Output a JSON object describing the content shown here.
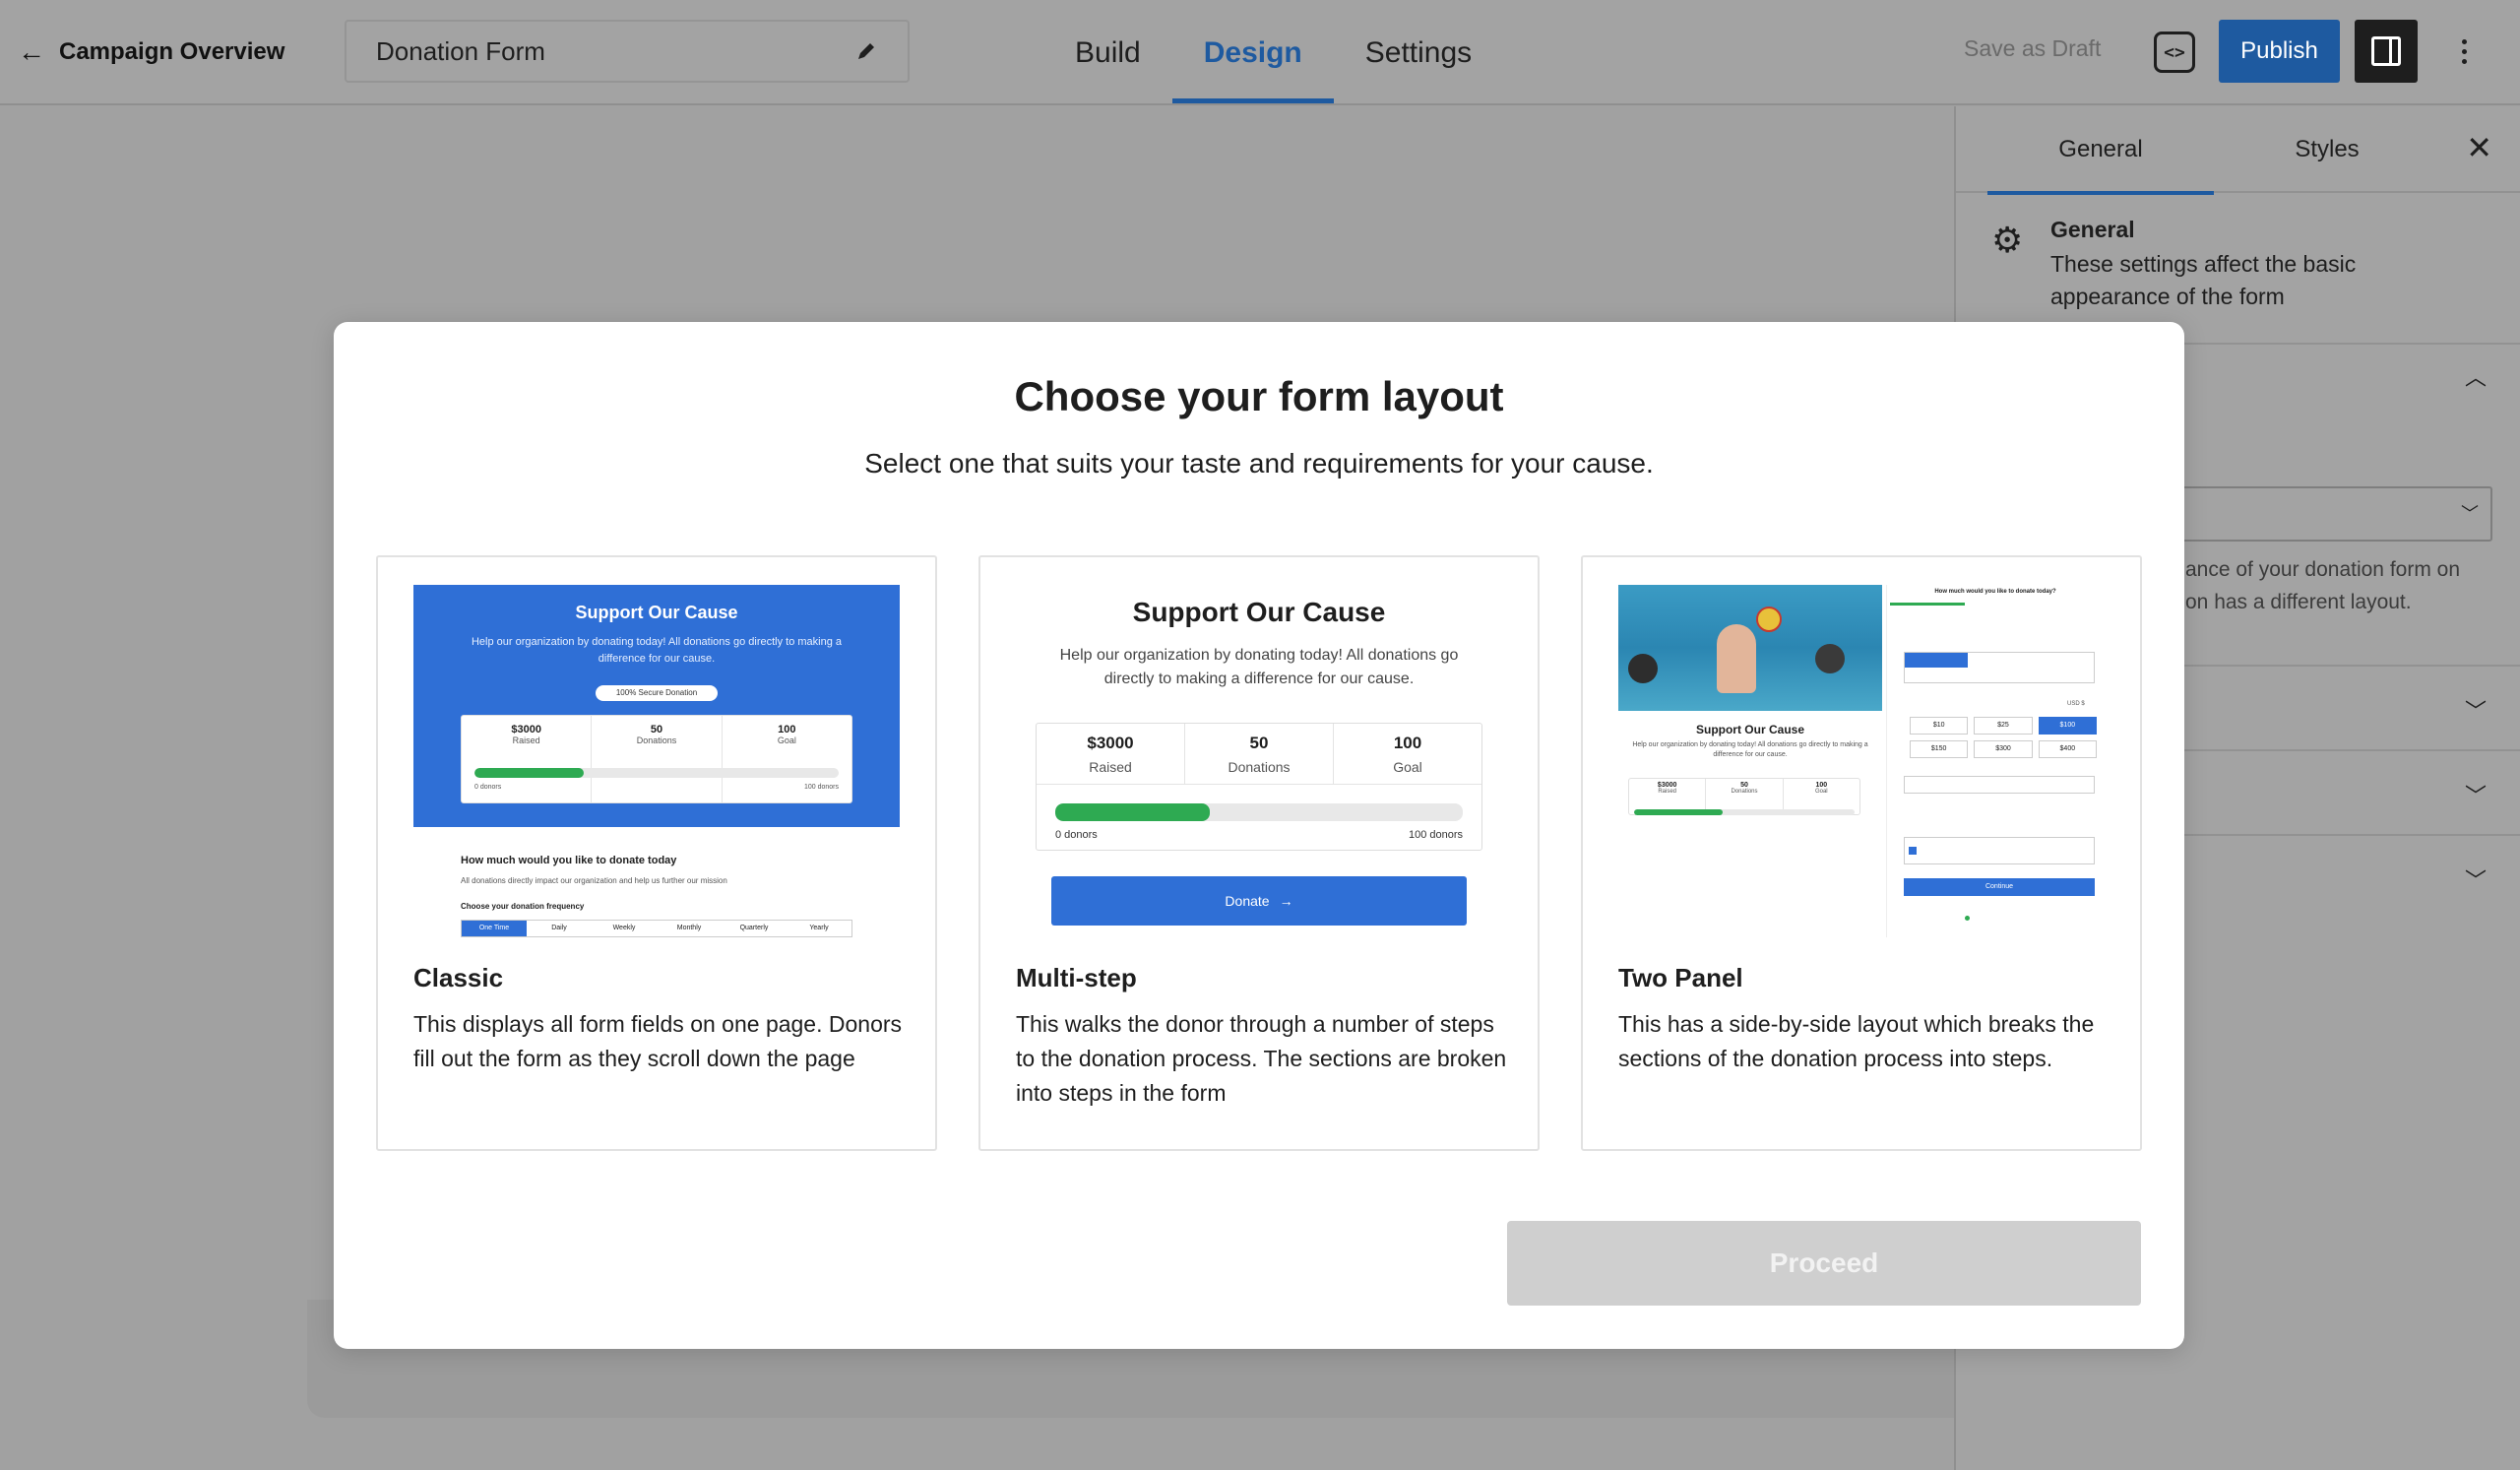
{
  "topbar": {
    "back_label": "Campaign Overview",
    "form_title": "Donation Form",
    "tabs": [
      {
        "label": "Build"
      },
      {
        "label": "Design"
      },
      {
        "label": "Settings"
      }
    ],
    "active_tab": "Design",
    "save_draft": "Save as Draft",
    "publish": "Publish"
  },
  "sidebar": {
    "tabs": [
      {
        "label": "General"
      },
      {
        "label": "Styles"
      }
    ],
    "section_title": "General",
    "section_desc": "These settings affect the basic appearance of the form",
    "partial_desc": "ance of your donation form on\non has a different layout."
  },
  "modal": {
    "title": "Choose your form layout",
    "subtitle": "Select one that suits your taste and requirements for your cause.",
    "proceed": "Proceed",
    "cards": [
      {
        "name": "Classic",
        "desc": "This displays all form fields on one page. Donors fill out the form as they scroll down the page",
        "preview": {
          "title": "Support Our Cause",
          "text": "Help our organization by donating today! All donations go directly to making a difference for our cause.",
          "badge": "100% Secure Donation",
          "stats": [
            {
              "value": "$3000",
              "label": "Raised"
            },
            {
              "value": "50",
              "label": "Donations"
            },
            {
              "value": "100",
              "label": "Goal"
            }
          ],
          "progress": 0.3,
          "bar_left": "0 donors",
          "bar_right": "100 donors",
          "question": "How much would you like to donate today",
          "question_sub": "All donations directly impact our organization and help us further our mission",
          "freq_label": "Choose your donation frequency",
          "freq": [
            "One Time",
            "Daily",
            "Weekly",
            "Monthly",
            "Quarterly",
            "Yearly"
          ]
        }
      },
      {
        "name": "Multi-step",
        "desc": "This walks the donor through a number of steps to the donation process. The sections are broken into steps in the form",
        "preview": {
          "title": "Support Our Cause",
          "text": "Help our organization by donating today! All donations go directly to making a difference for our cause.",
          "stats": [
            {
              "value": "$3000",
              "label": "Raised"
            },
            {
              "value": "50",
              "label": "Donations"
            },
            {
              "value": "100",
              "label": "Goal"
            }
          ],
          "progress": 0.38,
          "bar_left": "0 donors",
          "bar_right": "100 donors",
          "button": "Donate"
        }
      },
      {
        "name": "Two Panel",
        "desc": "This has a side-by-side layout which breaks the sections of the donation process into steps.",
        "preview": {
          "title": "Support Our Cause",
          "text": "Help our organization by donating today! All donations go directly to making a difference for our cause.",
          "stats": [
            {
              "value": "$3000",
              "label": "Raised"
            },
            {
              "value": "50",
              "label": "Donations"
            },
            {
              "value": "100",
              "label": "Goal"
            }
          ],
          "progress": 0.4,
          "question": "How much would you like to donate today?",
          "amounts": [
            "$10",
            "$25",
            "$100",
            "$150",
            "$300",
            "$400"
          ],
          "selected_amount": "$100",
          "currency": "USD $",
          "continue": "Continue"
        }
      }
    ]
  },
  "colors": {
    "accent": "#1e5aa0",
    "preview_blue": "#2f6fd6",
    "progress_green": "#2eaa52",
    "proceed_disabled": "#cfcfcf"
  }
}
